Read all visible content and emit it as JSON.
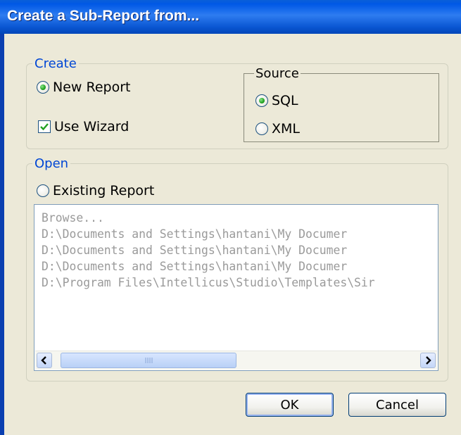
{
  "window": {
    "title": "Create a Sub-Report from..."
  },
  "create_group": {
    "legend": "Create",
    "new_report": {
      "label": "New Report",
      "selected": true
    },
    "use_wizard": {
      "label": "Use Wizard",
      "checked": true
    },
    "source": {
      "legend": "Source",
      "sql": {
        "label": "SQL",
        "selected": true
      },
      "xml": {
        "label": "XML",
        "selected": false
      }
    }
  },
  "open_group": {
    "legend": "Open",
    "existing_report": {
      "label": "Existing Report",
      "selected": false
    },
    "files": [
      "Browse...",
      "D:\\Documents and Settings\\hantani\\My Documer",
      "D:\\Documents and Settings\\hantani\\My Documer",
      "D:\\Documents and Settings\\hantani\\My Documer",
      "D:\\Program Files\\Intellicus\\Studio\\Templates\\Sir"
    ]
  },
  "buttons": {
    "ok": "OK",
    "cancel": "Cancel"
  },
  "icons": {
    "scroll_left": "chevron-left-icon",
    "scroll_right": "chevron-right-icon",
    "checkmark": "checkmark-icon",
    "grip": "grip-icon"
  },
  "colors": {
    "titlebar": "#0058e6",
    "dialog_bg": "#ece9d8",
    "legend_blue": "#0046d5",
    "radio_dot": "#21a121",
    "list_text": "#9a9a9a"
  }
}
